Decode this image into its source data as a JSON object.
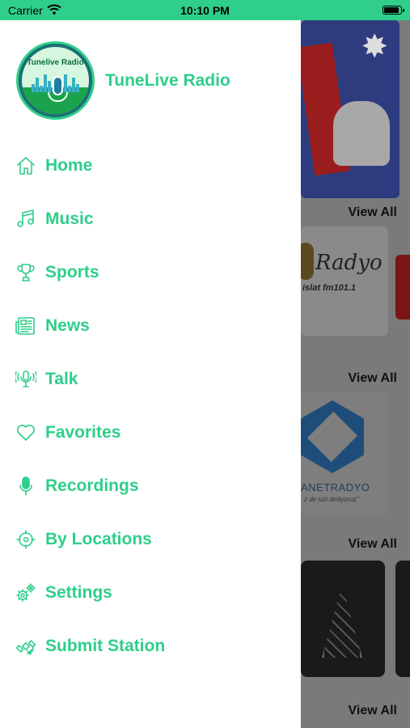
{
  "status_bar": {
    "carrier": "Carrier",
    "time": "10:10 PM",
    "battery_level": 0.95
  },
  "app": {
    "title": "TuneLive Radio",
    "logo_text": "Tunelive Radio"
  },
  "menu": {
    "items": [
      {
        "label": "Home",
        "icon": "home-icon"
      },
      {
        "label": "Music",
        "icon": "music-note-icon"
      },
      {
        "label": "Sports",
        "icon": "trophy-icon"
      },
      {
        "label": "News",
        "icon": "newspaper-icon"
      },
      {
        "label": "Talk",
        "icon": "podcast-icon"
      },
      {
        "label": "Favorites",
        "icon": "heart-icon"
      },
      {
        "label": "Recordings",
        "icon": "microphone-icon"
      },
      {
        "label": "By Locations",
        "icon": "location-target-icon"
      },
      {
        "label": "Settings",
        "icon": "gears-icon"
      },
      {
        "label": "Submit Station",
        "icon": "satellite-icon"
      }
    ]
  },
  "background": {
    "view_all_label": "View All",
    "card_texts": {
      "radyo": "Radyo",
      "radyo_sub": "islat fm101.1",
      "netradyo": "ANETRADYO",
      "netradyo_sub": "z de sizi dinliyoruz\""
    }
  },
  "colors": {
    "accent": "#2fce8a",
    "overlay": "#7a7a7a"
  }
}
